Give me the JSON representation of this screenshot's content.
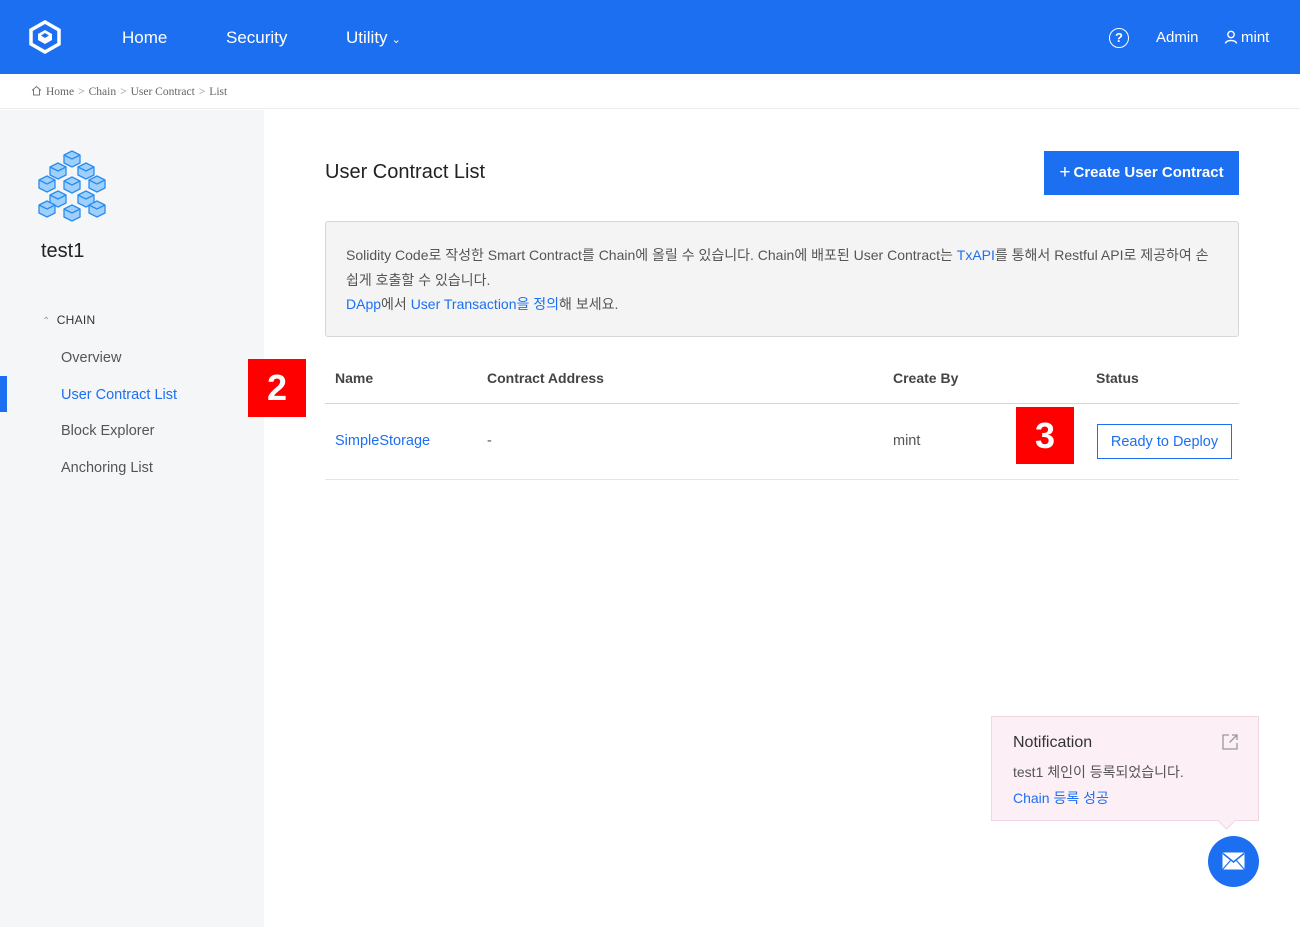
{
  "nav": {
    "items": [
      {
        "label": "Home"
      },
      {
        "label": "Security"
      },
      {
        "label": "Utility"
      }
    ],
    "help": "?",
    "admin": "Admin",
    "user": "mint"
  },
  "breadcrumb": [
    "Home",
    "Chain",
    "User Contract",
    "List"
  ],
  "sidebar": {
    "title": "test1",
    "section": "CHAIN",
    "items": [
      {
        "label": "Overview"
      },
      {
        "label": "User Contract List"
      },
      {
        "label": "Block Explorer"
      },
      {
        "label": "Anchoring List"
      }
    ],
    "active_index": 1
  },
  "markers": {
    "a": "2",
    "b": "3"
  },
  "main": {
    "title": "User Contract List",
    "create_button": "Create User Contract",
    "create_icon": "+",
    "info": {
      "p1_a": "Solidity Code로 작성한 Smart Contract를 Chain에 올릴 수 있습니다. Chain에 배포된 User Contract는 ",
      "p1_link": "TxAPI",
      "p1_b": "를 통해서 Restful API로 제공하여 손쉽게 호출할 수 있습니다.",
      "p2_link1": "DApp",
      "p2_mid": "에서 ",
      "p2_link2": "User Transaction을 정의",
      "p2_end": "해 보세요."
    },
    "table": {
      "headers": {
        "name": "Name",
        "address": "Contract Address",
        "created_by": "Create By",
        "status": "Status"
      },
      "rows": [
        {
          "name": "SimpleStorage",
          "address": "-",
          "created_by": "mint",
          "status": "Ready to Deploy"
        }
      ]
    }
  },
  "notification": {
    "title": "Notification",
    "message": "test1 체인이 등록되었습니다.",
    "link": "Chain 등록 성공"
  },
  "colors": {
    "primary": "#1d6ff2",
    "marker": "#ff0000",
    "sidebar_bg": "#f5f6f8"
  },
  "icons": [
    "logo-icon",
    "chevron-down-icon",
    "help-icon",
    "user-icon",
    "home-icon",
    "chain-cubes-icon",
    "plus-icon",
    "external-link-icon",
    "mail-icon"
  ]
}
